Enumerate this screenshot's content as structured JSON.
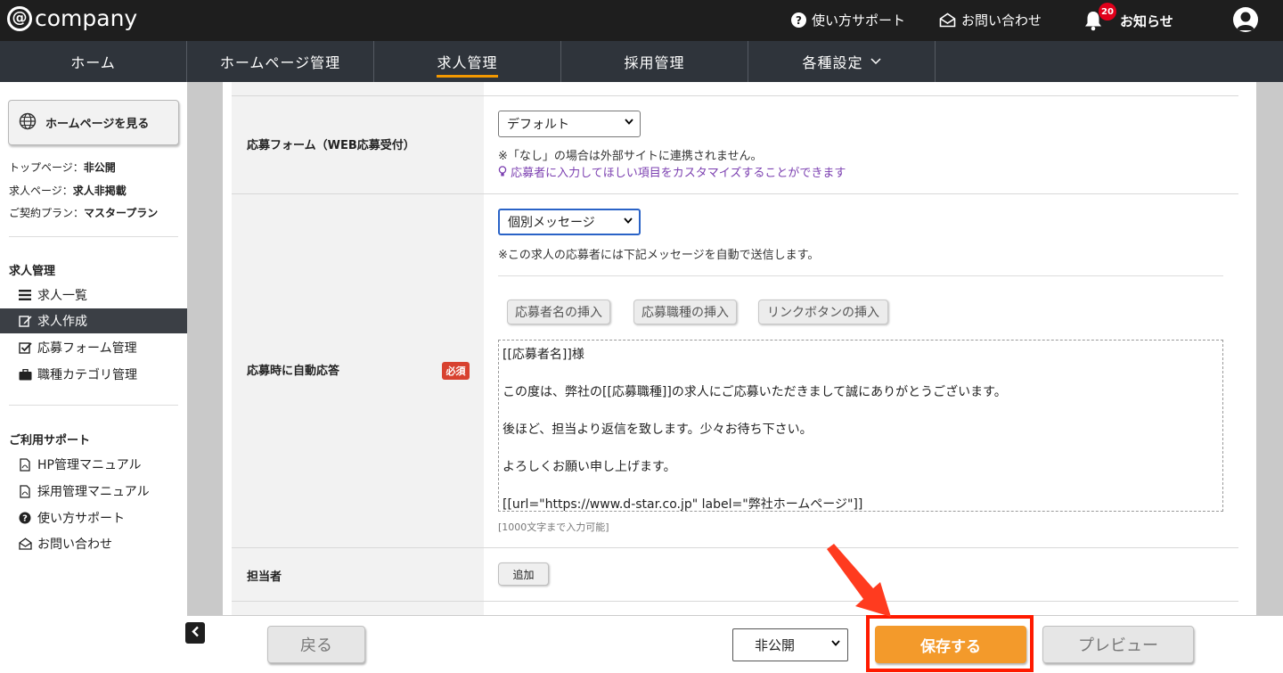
{
  "header": {
    "logo_mark": "@",
    "logo_text": "company",
    "support": "使い方サポート",
    "contact": "お問い合わせ",
    "notifications": "お知らせ",
    "notification_count": "20"
  },
  "nav": {
    "items": [
      {
        "label": "ホーム"
      },
      {
        "label": "ホームページ管理"
      },
      {
        "label": "求人管理"
      },
      {
        "label": "採用管理"
      },
      {
        "label": "各種設定"
      }
    ],
    "active": "求人管理"
  },
  "sidebar": {
    "view_button": "ホームページを見る",
    "status": [
      {
        "label": "トップページ：",
        "value": "非公開"
      },
      {
        "label": "求人ページ：",
        "value": "求人非掲載"
      },
      {
        "label": "ご契約プラン：",
        "value": "マスタープラン"
      }
    ],
    "section1": {
      "title": "求人管理",
      "items": [
        {
          "label": "求人一覧",
          "icon": "list-icon"
        },
        {
          "label": "求人作成",
          "icon": "edit-icon"
        },
        {
          "label": "応募フォーム管理",
          "icon": "checkbox-icon"
        },
        {
          "label": "職種カテゴリ管理",
          "icon": "briefcase-icon"
        }
      ],
      "active": "求人作成"
    },
    "section2": {
      "title": "ご利用サポート",
      "items": [
        {
          "label": "HP管理マニュアル",
          "icon": "pdf-icon"
        },
        {
          "label": "採用管理マニュアル",
          "icon": "pdf-icon"
        },
        {
          "label": "使い方サポート",
          "icon": "question-icon"
        },
        {
          "label": "お問い合わせ",
          "icon": "mail-icon"
        }
      ]
    }
  },
  "form": {
    "apply_form": {
      "label": "応募フォーム（WEB応募受付）",
      "selected": "デフォルト",
      "note": "※「なし」の場合は外部サイトに連携されません。",
      "link": "応募者に入力してほしい項目をカスタマイズすることができます"
    },
    "auto_reply": {
      "label": "応募時に自動応答",
      "required": "必須",
      "selected": "個別メッセージ",
      "note": "※この求人の応募者には下記メッセージを自動で送信します。",
      "insert_buttons": [
        "応募者名の挿入",
        "応募職種の挿入",
        "リンクボタンの挿入"
      ],
      "message_lines": [
        "[[応募者名]]様",
        "この度は、弊社の[[応募職種]]の求人にご応募いただきまして誠にありがとうございます。",
        "後ほど、担当より返信を致します。少々お待ち下さい。",
        "よろしくお願い申し上げます。",
        "[[url=\"https://www.d-star.co.jp\" label=\"弊社ホームページ\"]]"
      ],
      "limit": "[1000文字まで入力可能]"
    },
    "person": {
      "label": "担当者",
      "add_button": "追加"
    }
  },
  "bottom": {
    "back": "戻る",
    "visibility": "非公開",
    "save": "保存する",
    "preview": "プレビュー"
  },
  "colors": {
    "accent": "#f39800",
    "save": "#f39a2b",
    "highlight": "#ff1a00",
    "nav_bg": "#2f343b",
    "topbar_bg": "#1e1e1e"
  }
}
